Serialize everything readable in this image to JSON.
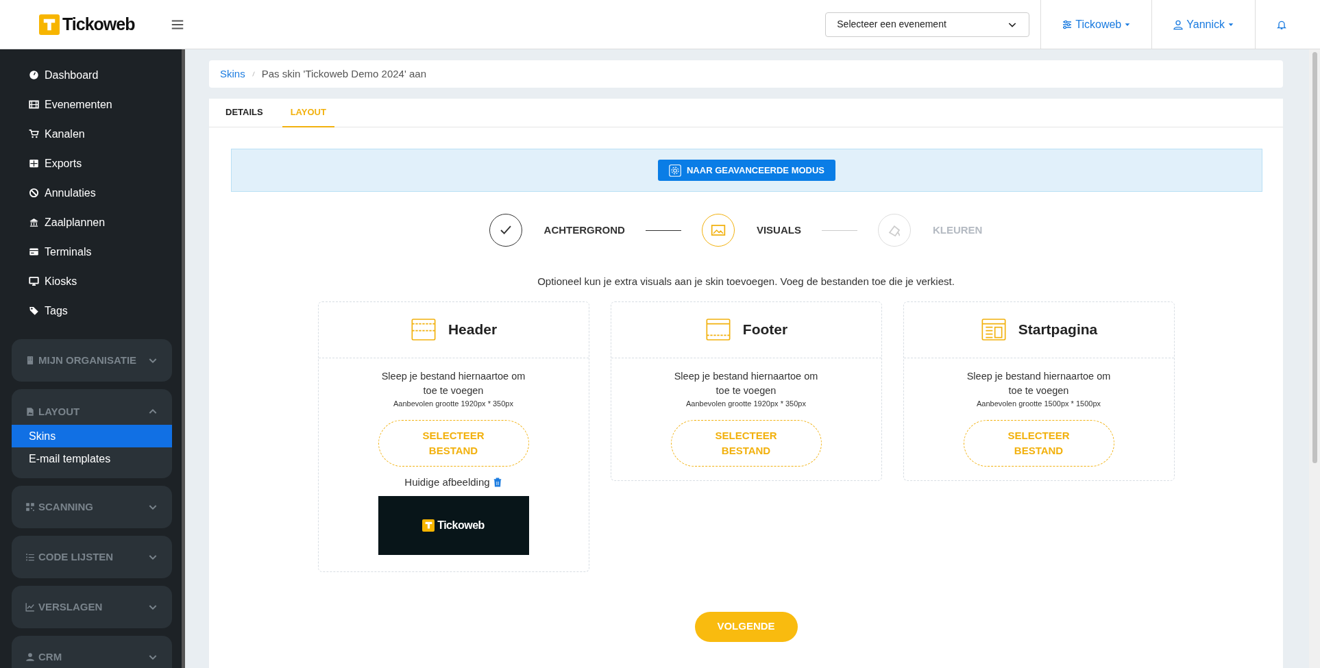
{
  "topbar": {
    "brand": "Tickoweb",
    "event_select": {
      "placeholder": "Selecteer een evenement"
    },
    "menus": [
      "Tickoweb",
      "Yannick"
    ]
  },
  "sidebar": {
    "items": [
      {
        "label": "Dashboard"
      },
      {
        "label": "Evenementen"
      },
      {
        "label": "Kanalen"
      },
      {
        "label": "Exports"
      },
      {
        "label": "Annulaties"
      },
      {
        "label": "Zaalplannen"
      },
      {
        "label": "Terminals"
      },
      {
        "label": "Kiosks"
      },
      {
        "label": "Tags"
      }
    ],
    "groups": [
      {
        "label": "MIJN ORGANISATIE",
        "expanded": false
      },
      {
        "label": "LAYOUT",
        "expanded": true,
        "children": [
          {
            "label": "Skins",
            "selected": true
          },
          {
            "label": "E-mail templates",
            "selected": false
          }
        ]
      },
      {
        "label": "SCANNING",
        "expanded": false
      },
      {
        "label": "CODE LIJSTEN",
        "expanded": false
      },
      {
        "label": "VERSLAGEN",
        "expanded": false
      },
      {
        "label": "CRM",
        "expanded": false
      }
    ]
  },
  "breadcrumb": [
    "Skins",
    "Pas skin 'Tickoweb Demo 2024' aan"
  ],
  "tabs": [
    {
      "label": "DETAILS",
      "selected": false
    },
    {
      "label": "LAYOUT",
      "selected": true
    }
  ],
  "advanced_button": "NAAR GEAVANCEERDE MODUS",
  "steps": [
    {
      "label": "ACHTERGROND",
      "completed": true,
      "selected": false
    },
    {
      "label": "VISUALS",
      "completed": false,
      "selected": true
    },
    {
      "label": "KLEUREN",
      "completed": false,
      "selected": false
    }
  ],
  "intro": "Optioneel kun je extra visuals aan je skin toevoegen. Voeg de bestanden toe die je verkiest.",
  "uploads": [
    {
      "title": "Header",
      "drop_text": "Sleep je bestand hiernaartoe om toe te voegen",
      "size_hint": "Aanbevolen grootte 1920px * 350px",
      "button": "SELECTEER BESTAND",
      "current": {
        "label": "Huidige afbeelding",
        "logo_text": "Tickoweb"
      }
    },
    {
      "title": "Footer",
      "drop_text": "Sleep je bestand hiernaartoe om toe te voegen",
      "size_hint": "Aanbevolen grootte 1920px * 350px",
      "button": "SELECTEER BESTAND"
    },
    {
      "title": "Startpagina",
      "drop_text": "Sleep je bestand hiernaartoe om toe te voegen",
      "size_hint": "Aanbevolen grootte 1500px * 1500px",
      "button": "SELECTEER BESTAND"
    }
  ],
  "next_button": "VOLGENDE"
}
